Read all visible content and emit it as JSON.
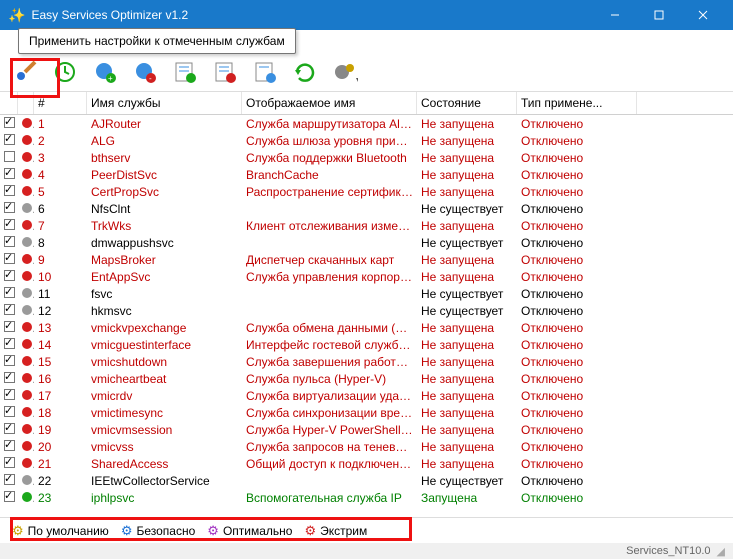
{
  "window": {
    "title": "Easy Services Optimizer v1.2"
  },
  "tooltip": "Применить настройки к отмеченным службам",
  "columns": {
    "num": "#",
    "name": "Имя службы",
    "display": "Отображаемое имя",
    "state": "Состояние",
    "apply": "Тип примене..."
  },
  "states": {
    "not_running": "Не запущена",
    "not_exist": "Не существует",
    "running": "Запущена",
    "disabled": "Отключено"
  },
  "rows": [
    {
      "n": 1,
      "chk": true,
      "dot": "red",
      "name": "AJRouter",
      "disp": "Служба маршрутизатора AllJ...",
      "state": "not_running",
      "red": true
    },
    {
      "n": 2,
      "chk": true,
      "dot": "red",
      "name": "ALG",
      "disp": "Служба шлюза уровня прило...",
      "state": "not_running",
      "red": true
    },
    {
      "n": 3,
      "chk": false,
      "dot": "red",
      "name": "bthserv",
      "disp": "Служба поддержки Bluetooth",
      "state": "not_running",
      "red": true
    },
    {
      "n": 4,
      "chk": true,
      "dot": "red",
      "name": "PeerDistSvc",
      "disp": "BranchCache",
      "state": "not_running",
      "red": true
    },
    {
      "n": 5,
      "chk": true,
      "dot": "red",
      "name": "CertPropSvc",
      "disp": "Распространение сертификата",
      "state": "not_running",
      "red": true
    },
    {
      "n": 6,
      "chk": true,
      "dot": "gray",
      "name": "NfsClnt",
      "disp": "",
      "state": "not_exist",
      "red": false
    },
    {
      "n": 7,
      "chk": true,
      "dot": "red",
      "name": "TrkWks",
      "disp": "Клиент отслеживания измени...",
      "state": "not_running",
      "red": true
    },
    {
      "n": 8,
      "chk": true,
      "dot": "gray",
      "name": "dmwappushsvc",
      "disp": "",
      "state": "not_exist",
      "red": false
    },
    {
      "n": 9,
      "chk": true,
      "dot": "red",
      "name": "MapsBroker",
      "disp": "Диспетчер скачанных карт",
      "state": "not_running",
      "red": true
    },
    {
      "n": 10,
      "chk": true,
      "dot": "red",
      "name": "EntAppSvc",
      "disp": "Служба управления корпора...",
      "state": "not_running",
      "red": true
    },
    {
      "n": 11,
      "chk": true,
      "dot": "gray",
      "name": "fsvc",
      "disp": "",
      "state": "not_exist",
      "red": false
    },
    {
      "n": 12,
      "chk": true,
      "dot": "gray",
      "name": "hkmsvc",
      "disp": "",
      "state": "not_exist",
      "red": false
    },
    {
      "n": 13,
      "chk": true,
      "dot": "red",
      "name": "vmickvpexchange",
      "disp": "Служба обмена данными (Hy...",
      "state": "not_running",
      "red": true
    },
    {
      "n": 14,
      "chk": true,
      "dot": "red",
      "name": "vmicguestinterface",
      "disp": "Интерфейс гостевой службы ...",
      "state": "not_running",
      "red": true
    },
    {
      "n": 15,
      "chk": true,
      "dot": "red",
      "name": "vmicshutdown",
      "disp": "Служба завершения работы ...",
      "state": "not_running",
      "red": true
    },
    {
      "n": 16,
      "chk": true,
      "dot": "red",
      "name": "vmicheartbeat",
      "disp": "Служба пульса (Hyper-V)",
      "state": "not_running",
      "red": true
    },
    {
      "n": 17,
      "chk": true,
      "dot": "red",
      "name": "vmicrdv",
      "disp": "Служба виртуализации удал...",
      "state": "not_running",
      "red": true
    },
    {
      "n": 18,
      "chk": true,
      "dot": "red",
      "name": "vmictimesync",
      "disp": "Служба синхронизации време...",
      "state": "not_running",
      "red": true
    },
    {
      "n": 19,
      "chk": true,
      "dot": "red",
      "name": "vmicvmsession",
      "disp": "Служба Hyper-V PowerShell Di...",
      "state": "not_running",
      "red": true
    },
    {
      "n": 20,
      "chk": true,
      "dot": "red",
      "name": "vmicvss",
      "disp": "Служба запросов на теневое ...",
      "state": "not_running",
      "red": true
    },
    {
      "n": 21,
      "chk": true,
      "dot": "red",
      "name": "SharedAccess",
      "disp": "Общий доступ к подключени...",
      "state": "not_running",
      "red": true
    },
    {
      "n": 22,
      "chk": true,
      "dot": "gray",
      "name": "IEEtwCollectorService",
      "disp": "",
      "state": "not_exist",
      "red": false
    },
    {
      "n": 23,
      "chk": true,
      "dot": "green",
      "name": "iphlpsvc",
      "disp": "Вспомогательная служба IP",
      "state": "running",
      "red": false,
      "green": true
    }
  ],
  "tabs": {
    "default": "По умолчанию",
    "safe": "Безопасно",
    "optimal": "Оптимально",
    "extreme": "Экстрим"
  },
  "statusbar": "Services_NT10.0"
}
